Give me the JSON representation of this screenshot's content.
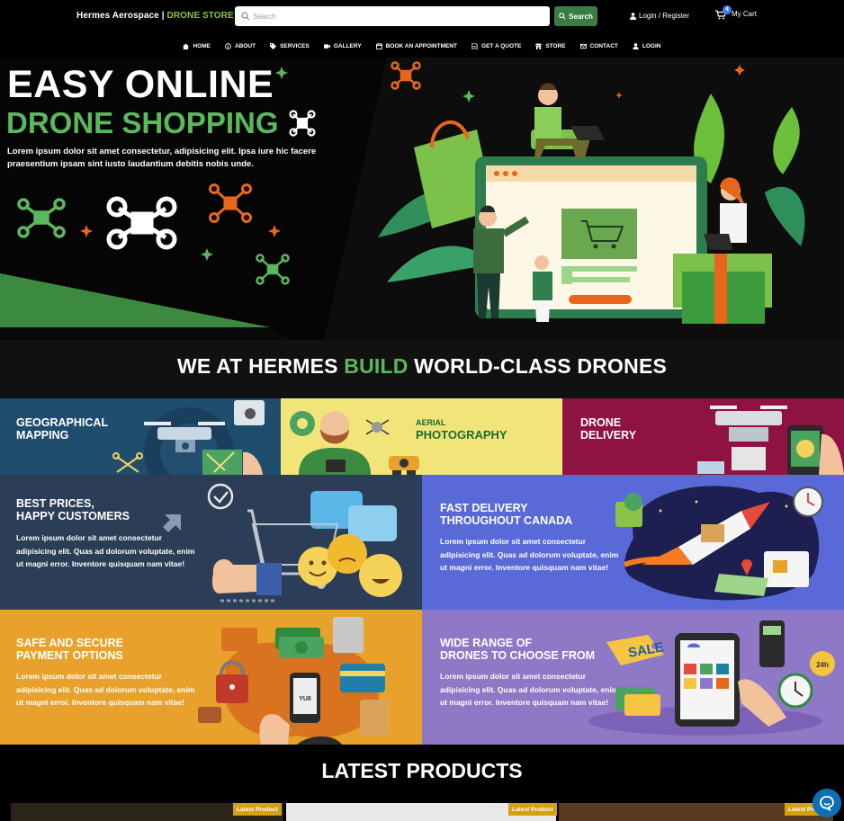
{
  "header": {
    "brand_name": "Hermes Aerospace",
    "brand_sep": " | ",
    "brand_store": "DRONE STORE",
    "search_placeholder": "Search",
    "search_button": "Search",
    "login_label": "Login / Register",
    "cart_label": "My Cart",
    "cart_count": "4"
  },
  "nav": {
    "items": [
      {
        "label": "HOME",
        "icon": "home-icon"
      },
      {
        "label": "ABOUT",
        "icon": "info-icon"
      },
      {
        "label": "SERVICES",
        "icon": "tag-icon"
      },
      {
        "label": "GALLERY",
        "icon": "camera-icon"
      },
      {
        "label": "BOOK AN APPOINTMENT",
        "icon": "calendar-icon"
      },
      {
        "label": "GET A QUOTE",
        "icon": "document-icon"
      },
      {
        "label": "STORE",
        "icon": "store-icon"
      },
      {
        "label": "CONTACT",
        "icon": "envelope-icon"
      },
      {
        "label": "LOGIN",
        "icon": "user-icon"
      }
    ]
  },
  "hero": {
    "title_line1": "EASY ONLINE",
    "title_line2": "DRONE SHOPPING",
    "text": "Lorem ipsum dolor sit amet consectetur, adipisicing elit. Ipsa iure hic facere praesentium ipsam sint iusto laudantium debitis nobis unde."
  },
  "headline": {
    "part1": "WE AT HERMES ",
    "part2": "BUILD",
    "part3": " WORLD-CLASS DRONES"
  },
  "services": {
    "mapping": {
      "title": "GEOGRAPHICAL\nMAPPING",
      "color": "#1f4d6e"
    },
    "photography": {
      "title_small": "AERIAL",
      "title_big": "PHOTOGRAPHY",
      "color": "#f1e57a"
    },
    "delivery": {
      "title": "DRONE\nDELIVERY",
      "color": "#8e1242"
    }
  },
  "features": [
    {
      "title": "BEST PRICES,\nHAPPY CUSTOMERS",
      "text": "Lorem ipsum dolor sit amet consectetur adipisicing elit. Quas ad dolorum voluptate, enim ut magni error. Inventore quisquam nam vitae!",
      "color": "#2c3e57"
    },
    {
      "title": "FAST DELIVERY\nTHROUGHOUT CANADA",
      "text": "Lorem ipsum dolor sit amet consectetur adipisicing elit. Quas ad dolorum voluptate, enim ut magni error. Inventore quisquam nam vitae!",
      "color": "#5a69d8"
    },
    {
      "title": "SAFE AND SECURE\nPAYMENT OPTIONS",
      "text": "Lorem ipsum dolor sit amet consectetur adipisicing elit. Quas ad dolorum voluptate, enim ut magni error. Inventore quisquam nam vitae!",
      "color": "#e8a22c"
    },
    {
      "title": "WIDE RANGE OF\nDRONES TO CHOOSE FROM",
      "text": "Lorem ipsum dolor sit amet consectetur adipisicing elit. Quas ad dolorum voluptate, enim ut magni error. Inventore quisquam nam vitae!",
      "color": "#8f78c6"
    }
  ],
  "latest": {
    "title": "LATEST PRODUCTS",
    "badge": "Latest Product"
  },
  "illustration_text": {
    "sale": "SALE",
    "clock": "24h",
    "vault": "YU8"
  },
  "colors": {
    "accent_green": "#5cb85c",
    "search_green": "#3a7d44",
    "badge_gold": "#d4a017",
    "chat_blue": "#0e6fb3"
  }
}
